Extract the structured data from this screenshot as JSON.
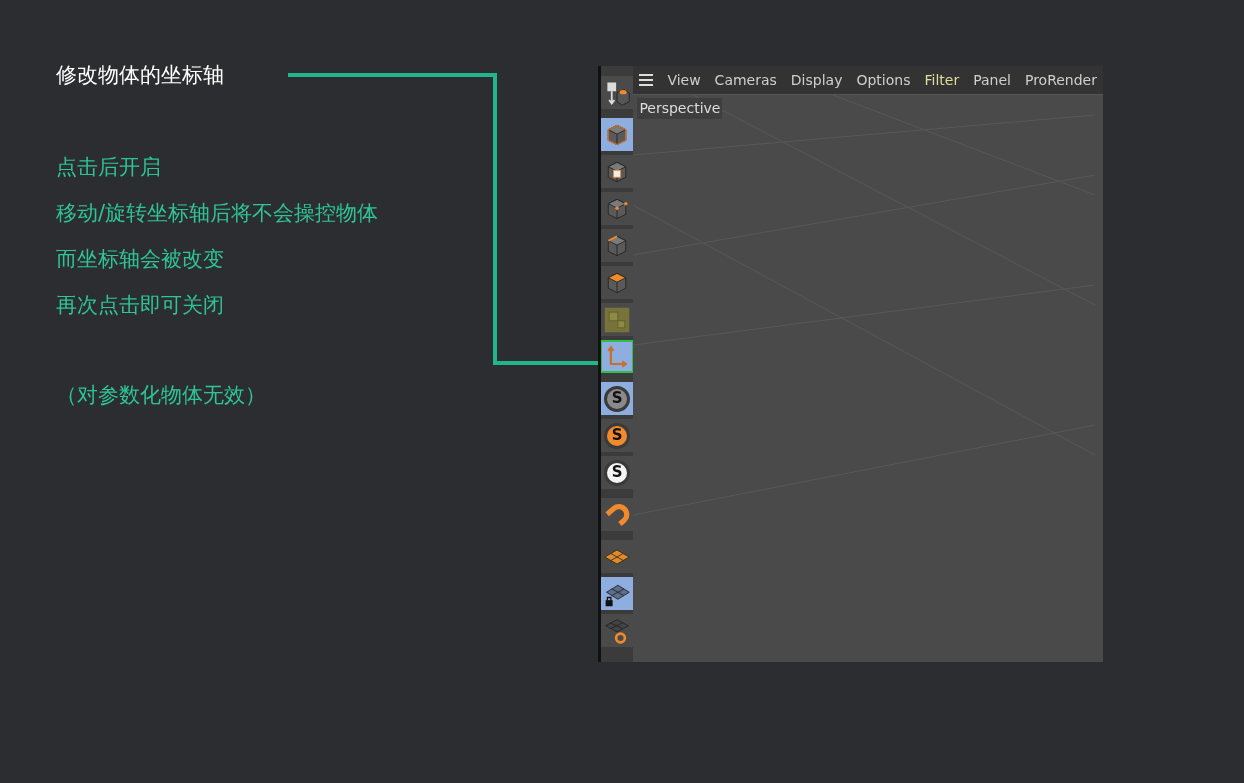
{
  "slide": {
    "title": "修改物体的坐标轴",
    "steps": [
      "点击后开启",
      "移动/旋转坐标轴后将不会操控物体",
      "而坐标轴会被改变",
      "再次点击即可关闭"
    ],
    "note": "（对参数化物体无效）"
  },
  "app": {
    "menu": [
      {
        "label": "View",
        "active": false
      },
      {
        "label": "Cameras",
        "active": false
      },
      {
        "label": "Display",
        "active": false
      },
      {
        "label": "Options",
        "active": false
      },
      {
        "label": "Filter",
        "active": true
      },
      {
        "label": "Panel",
        "active": false
      },
      {
        "label": "ProRender",
        "active": false
      }
    ],
    "viewport_label": "Perspective",
    "tool_groups": [
      {
        "tools": [
          {
            "kind": "object-mode",
            "selected": false,
            "highlighted": false
          }
        ]
      },
      {
        "tools": [
          {
            "kind": "model",
            "selected": true,
            "highlighted": false
          },
          {
            "kind": "texture",
            "selected": false,
            "highlighted": false
          },
          {
            "kind": "points",
            "selected": false,
            "highlighted": false
          },
          {
            "kind": "edges",
            "selected": false,
            "highlighted": false
          },
          {
            "kind": "polygons",
            "selected": false,
            "highlighted": false
          },
          {
            "kind": "uv",
            "selected": false,
            "highlighted": false
          },
          {
            "kind": "axis",
            "selected": true,
            "highlighted": true
          }
        ]
      },
      {
        "tools": [
          {
            "kind": "snap-gray",
            "letter": "S",
            "selected": true,
            "highlighted": false
          },
          {
            "kind": "snap-orange",
            "letter": "S",
            "selected": false,
            "highlighted": false
          },
          {
            "kind": "snap-white",
            "letter": "S",
            "selected": false,
            "highlighted": false
          }
        ]
      },
      {
        "tools": [
          {
            "kind": "magnet",
            "selected": false,
            "highlighted": false
          }
        ]
      },
      {
        "tools": [
          {
            "kind": "workplane",
            "selected": false,
            "highlighted": false
          },
          {
            "kind": "grid-lock",
            "selected": true,
            "highlighted": false
          },
          {
            "kind": "grid-ring",
            "selected": false,
            "highlighted": false
          }
        ]
      }
    ]
  }
}
